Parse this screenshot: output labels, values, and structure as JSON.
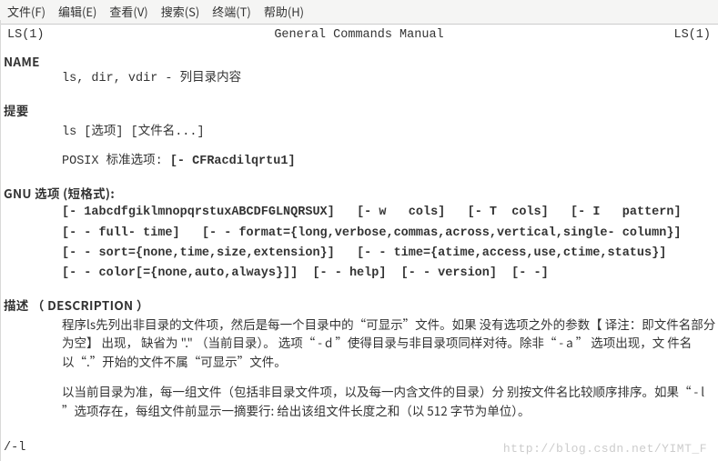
{
  "menubar": {
    "file": "文件(F)",
    "edit": "编辑(E)",
    "view": "查看(V)",
    "search": "搜索(S)",
    "term": "终端(T)",
    "help": "帮助(H)"
  },
  "header": {
    "left": "LS(1)",
    "center": "General Commands Manual",
    "right": "LS(1)"
  },
  "name": {
    "heading": "NAME",
    "body": "ls, dir, vdir - 列目录内容"
  },
  "synopsis": {
    "heading": "提要",
    "syn": "ls [选项] [文件名...]",
    "posix_label": "POSIX 标准选项:",
    "posix_opts": "[- CFRacdilqrtu1]"
  },
  "gnu": {
    "heading": "GNU 选项 (短格式):",
    "l1a": "[- 1abcdfgiklmnopqrstuxABCDFGLNQRSUX]",
    "l1b": "[- w",
    "l1c": "cols]",
    "l1d": "[- T  cols]",
    "l1e": "[- I",
    "l1f": "pattern]",
    "l2a": "[- - full- time]",
    "l2b": "[- - format={long,verbose,commas,across,vertical,single- column}]",
    "l3a": "[- - sort={none,time,size,extension}]",
    "l3b": "[- - time={atime,access,use,ctime,status}]",
    "l4": "[- - color[={none,auto,always}]]  [- - help]  [- - version]  [- -]"
  },
  "desc": {
    "heading": "描述 （ DESCRIPTION ）",
    "p1": "程序ls先列出非目录的文件项，然后是每一个目录中的“可显示”文件。如果 没有选项之外的参数【 译注：即文件名部分为空】 出现， 缺省为  \".\"   （当前目录）。 选项“   - d   ”使得目录与非目录项同样对待。除非“     - a       ”   选项出现，文 件名以“.”开始的文件不属“可显示”文件。",
    "p2": "以当前目录为准，每一组文件（包括非目录文件项，以及每一内含文件的目录）分 别按文件名比较顺序排序。如果“       - l      ”选项存在，每组文件前显示一摘要行: 给出该组文件长度之和（以 512 字节为单位）。"
  },
  "footer": "/-l",
  "watermark": "http://blog.csdn.net/YIMT_F"
}
